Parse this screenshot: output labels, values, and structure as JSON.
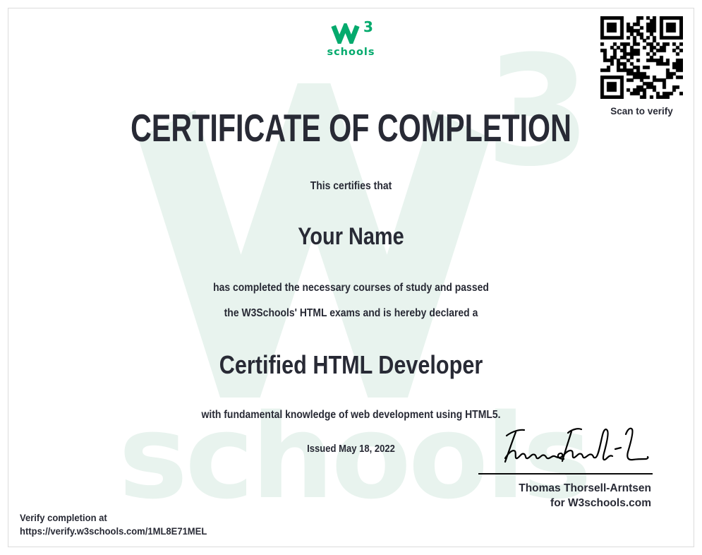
{
  "colors": {
    "green": "#04AA6D",
    "dark": "#282A35",
    "watermark": "#E8F3EE",
    "border": "#DBDBDB"
  },
  "brand": {
    "logo_superscript": "3",
    "logo_wordmark": "schools"
  },
  "qr": {
    "caption": "Scan to verify"
  },
  "watermark": {
    "superscript": "3",
    "wordmark": "schools"
  },
  "certificate": {
    "title": "CERTIFICATE OF COMPLETION",
    "certifies_line": "This certifies that",
    "recipient_name": "Your Name",
    "body_line_1": "has completed the necessary courses of study and passed",
    "body_line_2": "the W3Schools' HTML exams and is hereby declared a",
    "credential": "Certified HTML Developer",
    "body_line_3": "with fundamental knowledge of web development using HTML5.",
    "issued_line": "Issued May 18, 2022"
  },
  "signature": {
    "signatory_name": "Thomas Thorsell-Arntsen",
    "signatory_for": "for W3schools.com"
  },
  "verify": {
    "label": "Verify completion at",
    "url": "https://verify.w3schools.com/1ML8E71MEL"
  }
}
